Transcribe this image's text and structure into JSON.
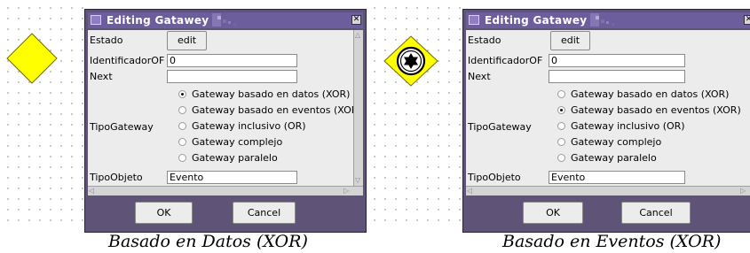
{
  "left": {
    "dialog": {
      "title": "Editing Gatawey",
      "estado_label": "Estado",
      "edit_button": "edit",
      "identificador_label": "IdentificadorOF",
      "identificador_value": "0",
      "next_label": "Next",
      "next_value": "",
      "tipogateway_label": "TipoGateway",
      "options": [
        "Gateway basado en datos (XOR)",
        "Gateway basado en eventos (XOR)",
        "Gateway inclusivo (OR)",
        "Gateway complejo",
        "Gateway paralelo"
      ],
      "selected": "Gateway basado en datos (XOR)",
      "tipoobjeto_label": "TipoObjeto",
      "tipoobjeto_value": "Evento",
      "ok_button": "OK",
      "cancel_button": "Cancel"
    },
    "caption": "Basado en Datos (XOR)"
  },
  "right": {
    "dialog": {
      "title": "Editing Gatawey",
      "estado_label": "Estado",
      "edit_button": "edit",
      "identificador_label": "IdentificadorOF",
      "identificador_value": "0",
      "next_label": "Next",
      "next_value": "",
      "tipogateway_label": "TipoGateway",
      "options": [
        "Gateway basado en datos (XOR)",
        "Gateway basado en eventos (XOR)",
        "Gateway inclusivo (OR)",
        "Gateway complejo",
        "Gateway paralelo"
      ],
      "selected": "Gateway basado en eventos (XOR)",
      "tipoobjeto_label": "TipoObjeto",
      "tipoobjeto_value": "Evento",
      "ok_button": "OK",
      "cancel_button": "Cancel"
    },
    "caption": "Basado en Eventos (XOR)"
  },
  "colors": {
    "gateway_fill": "#ffff00",
    "titlebar": "#6c5d9c",
    "dialog_frame": "#5f5478",
    "panel": "#ececec"
  }
}
